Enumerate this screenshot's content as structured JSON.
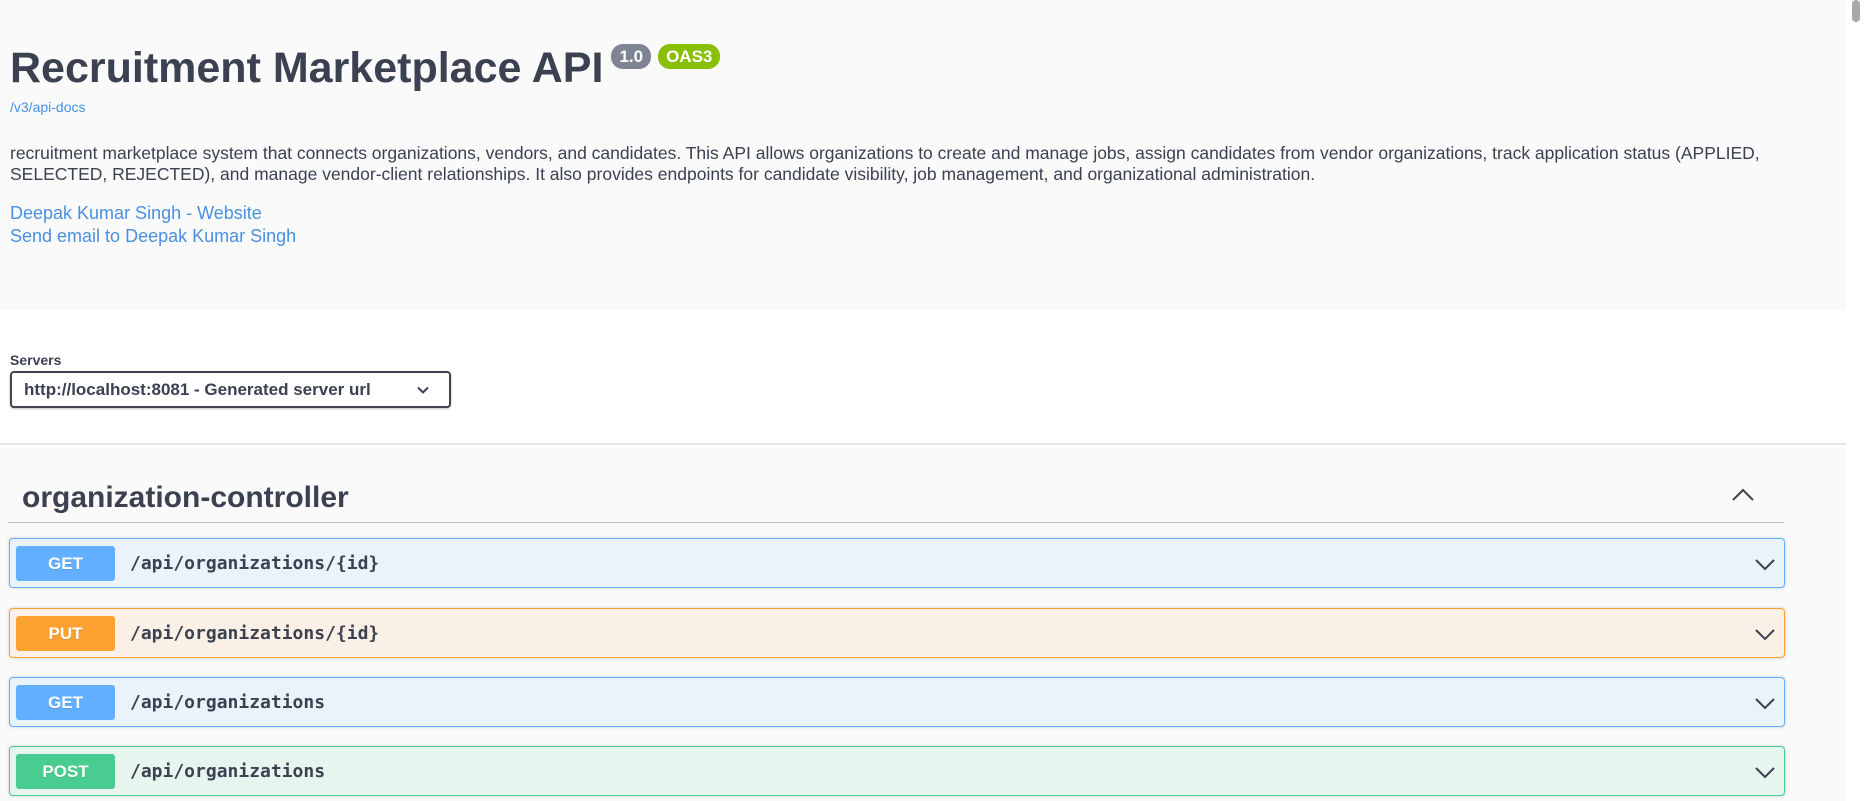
{
  "info": {
    "title": "Recruitment Marketplace API",
    "version": "1.0",
    "oas_badge": "OAS3",
    "spec_link": "/v3/api-docs",
    "description": "recruitment marketplace system that connects organizations, vendors, and candidates. This API allows organizations to create and manage jobs, assign candidates from vendor organizations, track application status (APPLIED, SELECTED, REJECTED), and manage vendor-client relationships. It also provides endpoints for candidate visibility, job management, and organizational administration.",
    "contact_website": "Deepak Kumar Singh - Website",
    "contact_email": "Send email to Deepak Kumar Singh"
  },
  "servers": {
    "label": "Servers",
    "selected": "http://localhost:8081 - Generated server url"
  },
  "tag": {
    "name": "organization-controller"
  },
  "operations": [
    {
      "method": "GET",
      "path": "/api/organizations/{id}"
    },
    {
      "method": "PUT",
      "path": "/api/organizations/{id}"
    },
    {
      "method": "GET",
      "path": "/api/organizations"
    },
    {
      "method": "POST",
      "path": "/api/organizations"
    }
  ],
  "colors": {
    "get": "#61affe",
    "put": "#fca130",
    "post": "#49cc90",
    "link": "#4990e2",
    "version_badge": "#7d8492",
    "oas_badge": "#89bf04"
  },
  "icons": {
    "server_select": "chevron-down-icon",
    "tag_toggle": "chevron-up-icon",
    "operation_expand": "chevron-down-icon"
  }
}
